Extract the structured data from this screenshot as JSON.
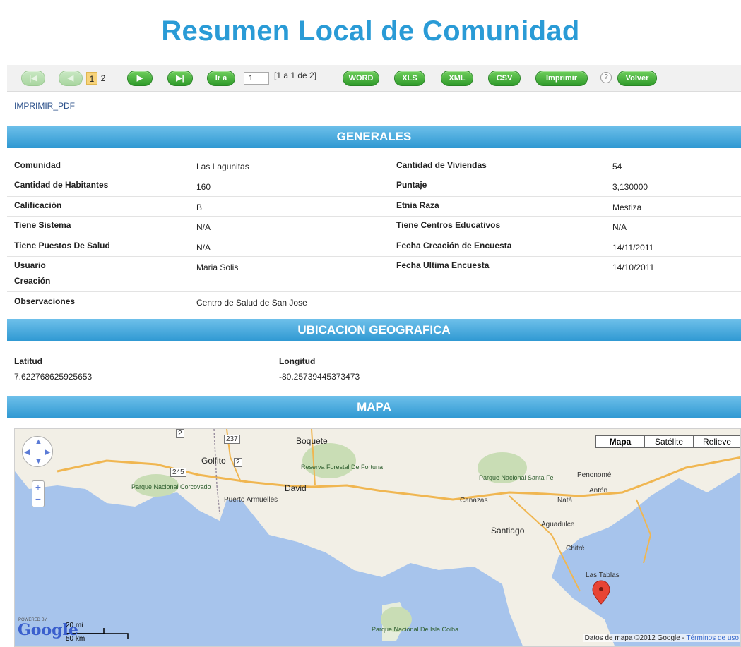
{
  "page_title": "Resumen Local de Comunidad",
  "toolbar": {
    "pages": [
      "1",
      "2"
    ],
    "goto_label": "Ir a",
    "goto_value": "1",
    "range_text": "[1 a 1 de 2]",
    "export_buttons": [
      "WORD",
      "XLS",
      "XML",
      "CSV",
      "Imprimir"
    ],
    "help_label": "?",
    "back_label": "Volver"
  },
  "pdf_link": "IMPRIMIR_PDF",
  "generales": {
    "title": "GENERALES",
    "left": [
      {
        "label": "Comunidad",
        "value": "Las Lagunitas"
      },
      {
        "label": "Cantidad de Habitantes",
        "value": "160"
      },
      {
        "label": "Calificación",
        "value": "B"
      },
      {
        "label": "Tiene Sistema",
        "value": "N/A"
      },
      {
        "label": "Tiene Puestos De Salud",
        "value": "N/A"
      },
      {
        "label": "Usuario",
        "label2": "Creación",
        "value": "Maria Solis"
      },
      {
        "label": "Observaciones",
        "value": "Centro de Salud de San Jose"
      }
    ],
    "right": [
      {
        "label": "Cantidad de Viviendas",
        "value": "54"
      },
      {
        "label": "Puntaje",
        "value": "3,130000"
      },
      {
        "label": "Etnia Raza",
        "value": "Mestiza"
      },
      {
        "label": "Tiene Centros Educativos",
        "value": "N/A"
      },
      {
        "label": "Fecha Creación de Encuesta",
        "value": "14/11/2011"
      },
      {
        "label": "Fecha Ultima Encuesta",
        "value": "14/10/2011"
      }
    ]
  },
  "ubicacion": {
    "title": "UBICACION GEOGRAFICA",
    "lat_label": "Latitud",
    "lat_value": "7.622768625925653",
    "lon_label": "Longitud",
    "lon_value": "-80.25739445373473"
  },
  "mapa": {
    "title": "MAPA",
    "map_types": [
      "Mapa",
      "Satélite",
      "Relieve"
    ],
    "cities": [
      "Boquete",
      "David",
      "Golfito",
      "Puerto Armuelles",
      "Canazas",
      "Santiago",
      "Penonomé",
      "Antón",
      "Natá",
      "Aguadulce",
      "Chitré",
      "Las Tablas"
    ],
    "parks": [
      "Reserva Forestal De Fortuna",
      "Parque Nacional Corcovado",
      "Parque Nacional Santa Fe",
      "Parque Nacional De Isla Coiba"
    ],
    "routes": [
      "237",
      "245",
      "2",
      "2"
    ],
    "powered_by": "POWERED BY",
    "logo": "Google",
    "scale_mi": "20 mi",
    "scale_km": "50 km",
    "attribution": "Datos de mapa ©2012 Google - ",
    "terms": "Términos de uso"
  }
}
